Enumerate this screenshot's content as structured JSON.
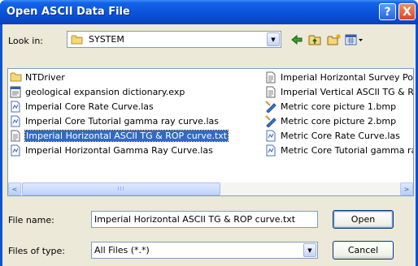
{
  "window": {
    "title": "Open ASCII Data File",
    "help_glyph": "?",
    "close_glyph": "X"
  },
  "look_in": {
    "label": "Look in:",
    "value": "SYSTEM"
  },
  "toolbar": {
    "icons": [
      "back-icon",
      "up-folder-icon",
      "new-folder-icon",
      "view-menu-icon"
    ]
  },
  "files": [
    {
      "name": "NTDriver",
      "type": "folder"
    },
    {
      "name": "geological expansion dictionary.exp",
      "type": "exp"
    },
    {
      "name": "Imperial Core Rate Curve.las",
      "type": "las"
    },
    {
      "name": "Imperial Core Tutorial gamma ray curve.las",
      "type": "las"
    },
    {
      "name": "Imperial Horizontal ASCII TG & ROP curve.txt",
      "type": "txt",
      "selected": true
    },
    {
      "name": "Imperial Horizontal Gamma Ray Curve.las",
      "type": "las"
    },
    {
      "name": "Imperial Horizontal Survey Po",
      "type": "txt"
    },
    {
      "name": "Imperial Vertical ASCII TG & R",
      "type": "txt"
    },
    {
      "name": "Metric core picture 1.bmp",
      "type": "bmp"
    },
    {
      "name": "Metric core picture 2.bmp",
      "type": "bmp"
    },
    {
      "name": "Metric Core Rate Curve.las",
      "type": "las"
    },
    {
      "name": "Metric Core Tutorial gamma ra",
      "type": "las"
    }
  ],
  "scrollbar": {
    "left_arrow": "<",
    "right_arrow": ">",
    "thumb_grip": "III"
  },
  "file_name": {
    "label": "File name:",
    "value": "Imperial Horizontal ASCII TG & ROP curve.txt"
  },
  "file_type": {
    "label": "Files of type:",
    "value": "All Files (*.*)"
  },
  "buttons": {
    "open": "Open",
    "cancel": "Cancel"
  },
  "colors": {
    "title_bar": "#0a54dc",
    "dialog_face": "#ece9d8",
    "selection": "#316ac5"
  }
}
